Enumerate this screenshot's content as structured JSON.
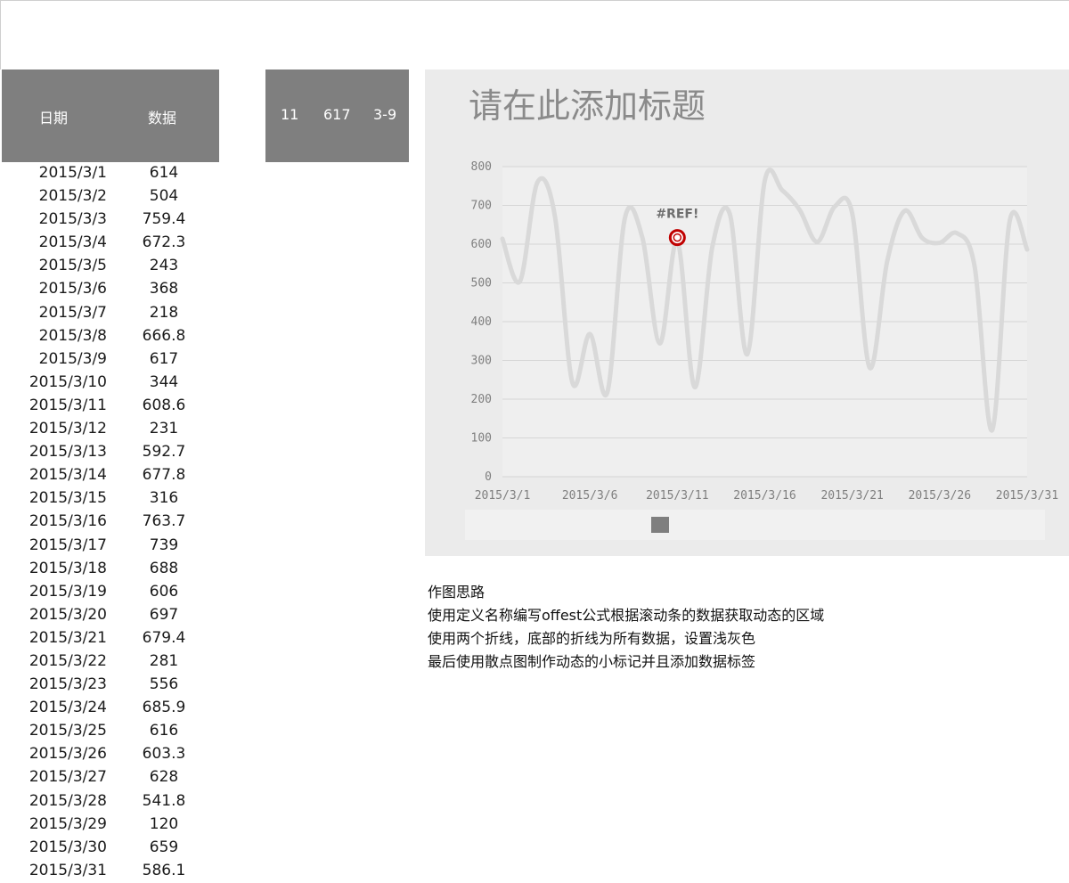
{
  "table": {
    "header": {
      "date": "日期",
      "value": "数据"
    },
    "rows": [
      {
        "d": "2015/3/1",
        "v": "614"
      },
      {
        "d": "2015/3/2",
        "v": "504"
      },
      {
        "d": "2015/3/3",
        "v": "759.4"
      },
      {
        "d": "2015/3/4",
        "v": "672.3"
      },
      {
        "d": "2015/3/5",
        "v": "243"
      },
      {
        "d": "2015/3/6",
        "v": "368"
      },
      {
        "d": "2015/3/7",
        "v": "218"
      },
      {
        "d": "2015/3/8",
        "v": "666.8"
      },
      {
        "d": "2015/3/9",
        "v": "617"
      },
      {
        "d": "2015/3/10",
        "v": "344"
      },
      {
        "d": "2015/3/11",
        "v": "608.6"
      },
      {
        "d": "2015/3/12",
        "v": "231"
      },
      {
        "d": "2015/3/13",
        "v": "592.7"
      },
      {
        "d": "2015/3/14",
        "v": "677.8"
      },
      {
        "d": "2015/3/15",
        "v": "316"
      },
      {
        "d": "2015/3/16",
        "v": "763.7"
      },
      {
        "d": "2015/3/17",
        "v": "739"
      },
      {
        "d": "2015/3/18",
        "v": "688"
      },
      {
        "d": "2015/3/19",
        "v": "606"
      },
      {
        "d": "2015/3/20",
        "v": "697"
      },
      {
        "d": "2015/3/21",
        "v": "679.4"
      },
      {
        "d": "2015/3/22",
        "v": "281"
      },
      {
        "d": "2015/3/23",
        "v": "556"
      },
      {
        "d": "2015/3/24",
        "v": "685.9"
      },
      {
        "d": "2015/3/25",
        "v": "616"
      },
      {
        "d": "2015/3/26",
        "v": "603.3"
      },
      {
        "d": "2015/3/27",
        "v": "628"
      },
      {
        "d": "2015/3/28",
        "v": "541.8"
      },
      {
        "d": "2015/3/29",
        "v": "120"
      },
      {
        "d": "2015/3/30",
        "v": "659"
      },
      {
        "d": "2015/3/31",
        "v": "586.1"
      }
    ]
  },
  "control": {
    "index": "11",
    "value": "617",
    "date": "3-9"
  },
  "chart_data": {
    "type": "line",
    "title": "请在此添加标题",
    "x": [
      "2015/3/1",
      "2015/3/2",
      "2015/3/3",
      "2015/3/4",
      "2015/3/5",
      "2015/3/6",
      "2015/3/7",
      "2015/3/8",
      "2015/3/9",
      "2015/3/10",
      "2015/3/11",
      "2015/3/12",
      "2015/3/13",
      "2015/3/14",
      "2015/3/15",
      "2015/3/16",
      "2015/3/17",
      "2015/3/18",
      "2015/3/19",
      "2015/3/20",
      "2015/3/21",
      "2015/3/22",
      "2015/3/23",
      "2015/3/24",
      "2015/3/25",
      "2015/3/26",
      "2015/3/27",
      "2015/3/28",
      "2015/3/29",
      "2015/3/30",
      "2015/3/31"
    ],
    "values": [
      614,
      504,
      759.4,
      672.3,
      243,
      368,
      218,
      666.8,
      617,
      344,
      608.6,
      231,
      592.7,
      677.8,
      316,
      763.7,
      739,
      688,
      606,
      697,
      679.4,
      281,
      556,
      685.9,
      616,
      603.3,
      628,
      541.8,
      120,
      659,
      586.1
    ],
    "x_tick_labels": [
      "2015/3/1",
      "2015/3/6",
      "2015/3/11",
      "2015/3/16",
      "2015/3/21",
      "2015/3/26",
      "2015/3/31"
    ],
    "y_ticks": [
      0,
      100,
      200,
      300,
      400,
      500,
      600,
      700,
      800
    ],
    "ylim": [
      0,
      800
    ],
    "grid": true,
    "highlight": {
      "x_index": 10,
      "value": 617,
      "label": "#REF!"
    },
    "line_color": "#d9d9d9",
    "marker_color": "#c00000"
  },
  "notes": {
    "heading": "作图思路",
    "lines": [
      "使用定义名称编写offest公式根据滚动条的数据获取动态的区域",
      "使用两个折线，底部的折线为所有数据，设置浅灰色",
      "最后使用散点图制作动态的小标记并且添加数据标签"
    ]
  }
}
